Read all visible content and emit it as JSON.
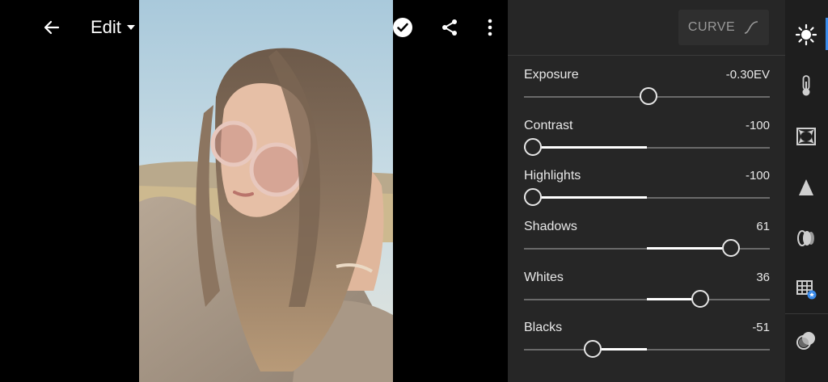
{
  "toolbar": {
    "title": "Edit",
    "icons": [
      "back-arrow-icon",
      "dropdown-caret-icon",
      "undo-icon",
      "help-icon",
      "done-check-icon",
      "share-icon",
      "more-vertical-icon"
    ]
  },
  "panel": {
    "curve_label": "CURVE",
    "sliders": [
      {
        "label": "Exposure",
        "value": "-0.30EV",
        "position": 0.47,
        "center": 0.5
      },
      {
        "label": "Contrast",
        "value": "-100",
        "position": 0.0,
        "center": 0.5
      },
      {
        "label": "Highlights",
        "value": "-100",
        "position": 0.0,
        "center": 0.5
      },
      {
        "label": "Shadows",
        "value": "61",
        "position": 0.805,
        "center": 0.5
      },
      {
        "label": "Whites",
        "value": "36",
        "position": 0.68,
        "center": 0.5
      },
      {
        "label": "Blacks",
        "value": "-51",
        "position": 0.245,
        "center": 0.5
      }
    ]
  },
  "sidebar": {
    "items": [
      "light-icon",
      "color-temperature-icon",
      "effects-vignette-icon",
      "detail-icon",
      "optics-icon",
      "geometry-icon",
      "presets-icon"
    ],
    "active": "light-icon",
    "accent": "#3b8bea"
  },
  "colors": {
    "panel": "#262626",
    "sidebar": "#1e1e1e",
    "background": "#000000"
  }
}
